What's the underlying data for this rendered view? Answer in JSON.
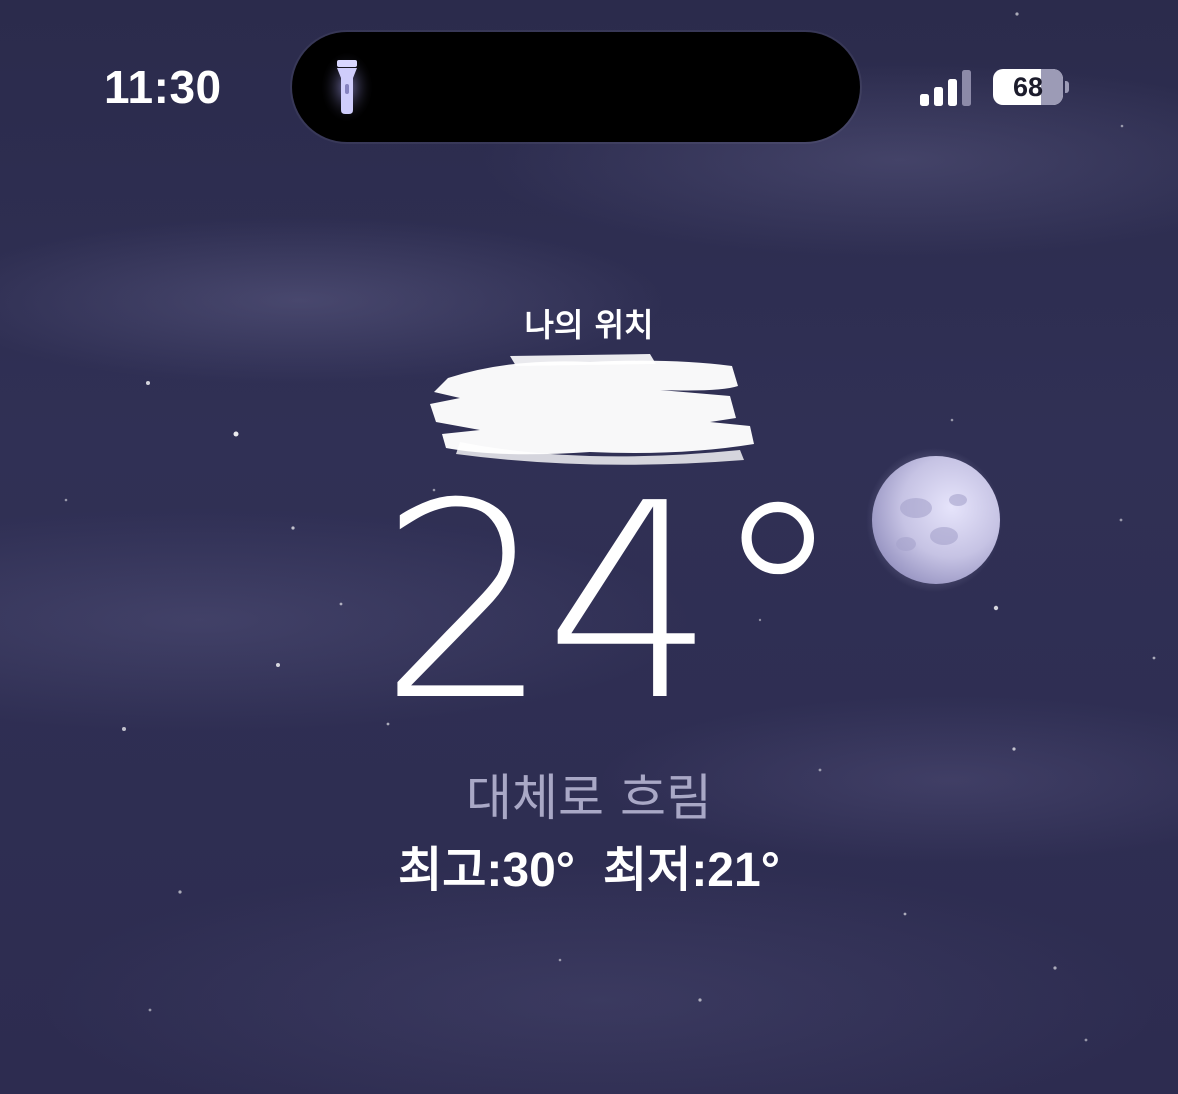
{
  "status_bar": {
    "time": "11:30",
    "battery_percent": "68",
    "battery_level": 0.68,
    "signal_bars_active": 3,
    "flashlight_icon": "flashlight-icon"
  },
  "weather": {
    "location_label": "나의 위치",
    "temperature": "24°",
    "condition": "대체로 흐림",
    "high": "최고:30°",
    "low": "최저:21°"
  },
  "colors": {
    "sky": "#2d2c50",
    "condition_text": "#a9a8c6",
    "moon": "#c9c8e6"
  }
}
